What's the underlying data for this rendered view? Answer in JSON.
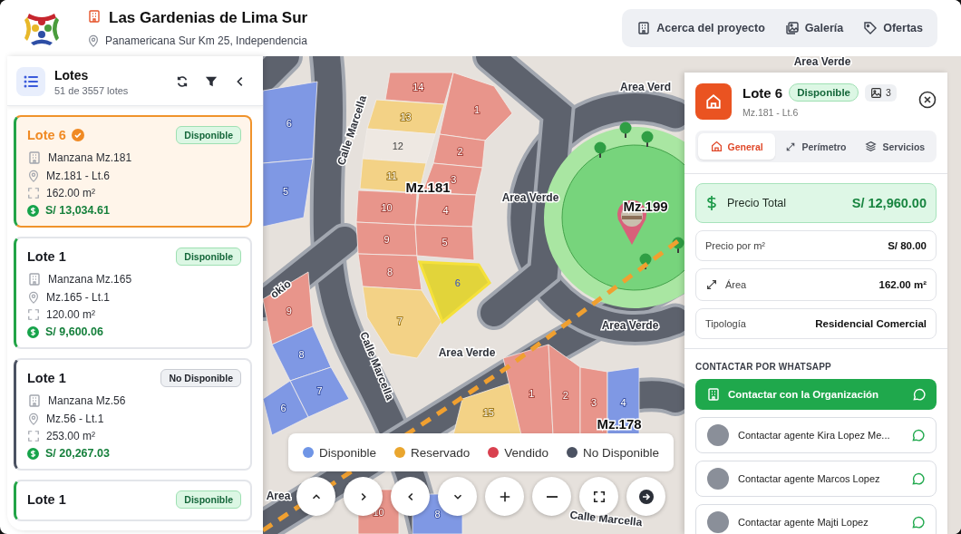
{
  "header": {
    "title": "Las Gardenias de Lima Sur",
    "address": "Panamericana Sur Km 25, Independencia",
    "nav": [
      {
        "label": "Acerca del proyecto",
        "kind": "building"
      },
      {
        "label": "Galería",
        "kind": "gallery"
      },
      {
        "label": "Ofertas",
        "kind": "tag"
      }
    ]
  },
  "lots_panel": {
    "title": "Lotes",
    "count": "51 de 3557 lotes",
    "cards": [
      {
        "title": "Lote 6",
        "selected": true,
        "status": "Disponible",
        "kind": "available",
        "manzana": "Manzana Mz.181",
        "location": "Mz.181 - Lt.6",
        "area": "162.00 m²",
        "price": "S/ 13,034.61"
      },
      {
        "title": "Lote 1",
        "selected": false,
        "status": "Disponible",
        "kind": "available",
        "manzana": "Manzana Mz.165",
        "location": "Mz.165 - Lt.1",
        "area": "120.00 m²",
        "price": "S/ 9,600.06"
      },
      {
        "title": "Lote 1",
        "selected": false,
        "status": "No Disponible",
        "kind": "unavailable",
        "manzana": "Manzana Mz.56",
        "location": "Mz.56 - Lt.1",
        "area": "253.00 m²",
        "price": "S/ 20,267.03"
      },
      {
        "title": "Lote 1",
        "selected": false,
        "status": "Disponible",
        "kind": "available"
      }
    ]
  },
  "map": {
    "lots": [
      {
        "number": "14",
        "kind": "sold",
        "selected": false
      },
      {
        "number": "13",
        "kind": "reserved",
        "selected": false
      },
      {
        "number": "12",
        "kind": "unavailable",
        "selected": false
      },
      {
        "number": "11",
        "kind": "reserved",
        "selected": false
      },
      {
        "number": "10",
        "kind": "sold",
        "selected": false
      },
      {
        "number": "9",
        "kind": "sold",
        "selected": false
      },
      {
        "number": "8",
        "kind": "sold",
        "selected": false
      },
      {
        "number": "7",
        "kind": "reserved",
        "selected": false
      },
      {
        "number": "1",
        "kind": "sold",
        "selected": false
      },
      {
        "number": "2",
        "kind": "sold",
        "selected": false
      },
      {
        "number": "3",
        "kind": "sold",
        "selected": false
      },
      {
        "number": "4",
        "kind": "sold",
        "selected": false
      },
      {
        "number": "5",
        "kind": "sold",
        "selected": false
      },
      {
        "number": "6",
        "kind": "available",
        "selected": true
      },
      {
        "number": "6",
        "kind": "available",
        "selected": false
      },
      {
        "number": "5",
        "kind": "available",
        "selected": false
      },
      {
        "number": "9",
        "kind": "sold",
        "selected": false
      },
      {
        "number": "8",
        "kind": "available",
        "selected": false
      },
      {
        "number": "7",
        "kind": "available",
        "selected": false
      },
      {
        "number": "6",
        "kind": "available",
        "selected": false
      },
      {
        "number": "15",
        "kind": "reserved",
        "selected": false
      },
      {
        "number": "1",
        "kind": "sold",
        "selected": false
      },
      {
        "number": "2",
        "kind": "sold",
        "selected": false
      },
      {
        "number": "3",
        "kind": "sold",
        "selected": false
      },
      {
        "number": "4",
        "kind": "available",
        "selected": false
      },
      {
        "number": "10",
        "kind": "sold",
        "selected": false
      },
      {
        "number": "8",
        "kind": "available",
        "selected": false
      }
    ],
    "labels": [
      {
        "text": "Mz.181",
        "kind": "block"
      },
      {
        "text": "Mz.199",
        "kind": "block"
      },
      {
        "text": "Mz.178",
        "kind": "block"
      },
      {
        "text": "Area Verde",
        "kind": "area"
      },
      {
        "text": "Area Verd",
        "kind": "area"
      },
      {
        "text": "Area Verde",
        "kind": "area"
      },
      {
        "text": "Area Verde",
        "kind": "area"
      },
      {
        "text": "Area Verde",
        "kind": "area"
      },
      {
        "text": "Area",
        "kind": "area"
      },
      {
        "text": "Calle Marcella",
        "kind": "street"
      },
      {
        "text": "Calle Marcella",
        "kind": "street"
      },
      {
        "text": "Calle Marcella",
        "kind": "street"
      },
      {
        "text": "okio",
        "kind": "street"
      }
    ]
  },
  "legend": [
    {
      "label": "Disponible",
      "color": "#6f95e6"
    },
    {
      "label": "Reservado",
      "color": "#eaa62e"
    },
    {
      "label": "Vendido",
      "color": "#d9404f"
    },
    {
      "label": "No Disponible",
      "color": "#4b5262"
    }
  ],
  "map_controls": [
    {
      "kind": "up"
    },
    {
      "kind": "right"
    },
    {
      "kind": "left"
    },
    {
      "kind": "down"
    },
    {
      "kind": "zoom_in"
    },
    {
      "kind": "zoom_out"
    },
    {
      "kind": "fullscreen"
    },
    {
      "kind": "go"
    }
  ],
  "detail": {
    "title": "Lote 6",
    "status": "Disponible",
    "kind": "available",
    "photos": "3",
    "subtitle": "Mz.181 - Lt.6",
    "tabs": [
      {
        "label": "General",
        "kind": "home",
        "selected": true
      },
      {
        "label": "Perímetro",
        "kind": "expand",
        "selected": false
      },
      {
        "label": "Servicios",
        "kind": "layers",
        "selected": false
      }
    ],
    "total": {
      "label": "Precio Total",
      "value": "S/ 12,960.00"
    },
    "rows": [
      {
        "label": "Precio por m²",
        "value": "S/ 80.00",
        "kind": "plain"
      },
      {
        "label": "Área",
        "value": "162.00 m²",
        "kind": "area"
      },
      {
        "label": "Tipología",
        "value": "Residencial Comercial",
        "kind": "plain"
      }
    ],
    "contact_heading": "CONTACTAR POR WHATSAPP",
    "contacts": [
      {
        "label": "Contactar con la Organización",
        "kind": "organization"
      },
      {
        "label": "Contactar agente Kira Lopez Me...",
        "kind": "agent"
      },
      {
        "label": "Contactar agente Marcos Lopez",
        "kind": "agent"
      },
      {
        "label": "Contactar agente Majti Lopez",
        "kind": "agent"
      }
    ]
  }
}
